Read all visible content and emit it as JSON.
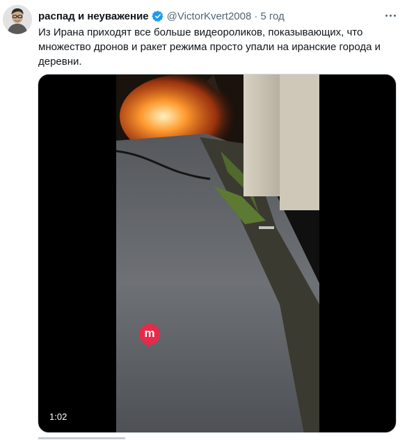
{
  "tweet": {
    "display_name": "распад и неуважение",
    "handle": "@VictorKvert2008",
    "separator": "·",
    "time": "5 год",
    "text": "Из Ирана приходят все больше видеороликов, показывающих, что множество дронов и ракет режима просто упали на иранские города и деревни.",
    "verified_icon": "verified-badge-icon",
    "more_icon": "more-options-icon"
  },
  "media": {
    "duration": "1:02",
    "watermark_icon": "media-logo-icon"
  },
  "colors": {
    "text": "#0f1419",
    "secondary": "#536471",
    "verified": "#1d9bf0",
    "border": "#cfd9de"
  }
}
